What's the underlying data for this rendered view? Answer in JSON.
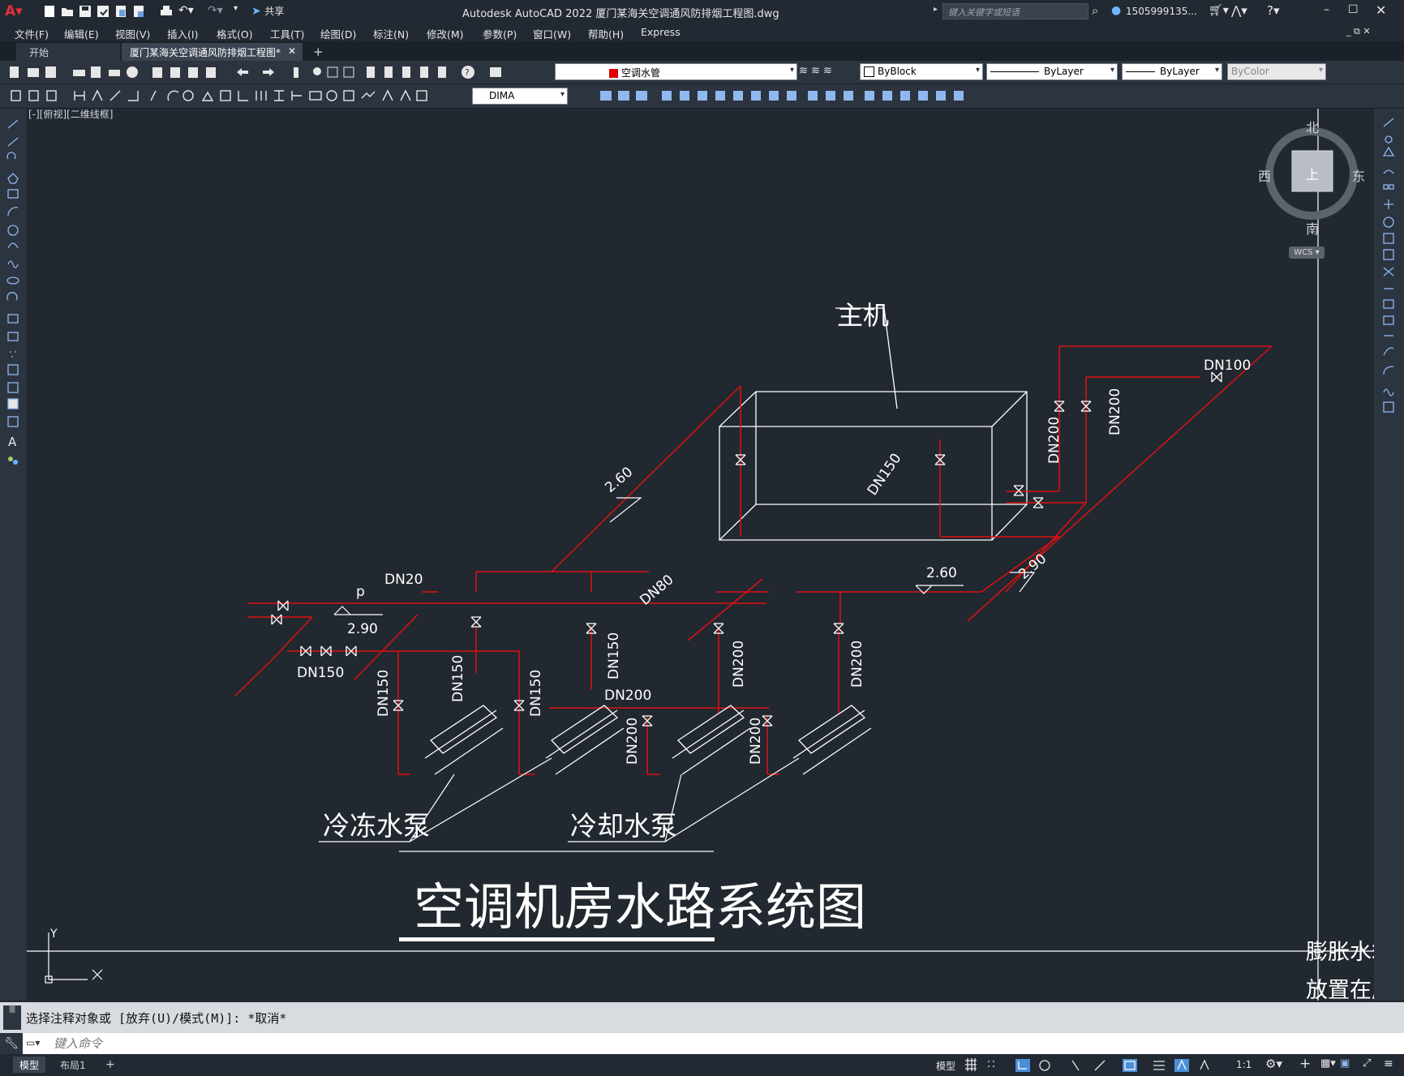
{
  "title_bar": {
    "app_title": "Autodesk AutoCAD 2022    厦门某海关空调通风防排烟工程图.dwg",
    "share_label": "共享",
    "search_placeholder": "键入关键字或短语",
    "user_name": "1505999135..."
  },
  "menu": [
    "文件(F)",
    "编辑(E)",
    "视图(V)",
    "插入(I)",
    "格式(O)",
    "工具(T)",
    "绘图(D)",
    "标注(N)",
    "修改(M)",
    "参数(P)",
    "窗口(W)",
    "帮助(H)",
    "Express"
  ],
  "tabs": {
    "start": "开始",
    "active": "厦门某海关空调通风防排烟工程图*"
  },
  "layer_combo": "空调水管",
  "color_combo": "ByBlock",
  "linetype_combo": "ByLayer",
  "lineweight_combo": "ByLayer",
  "plotstyle_combo": "ByColor",
  "dimstyle_combo": "DIMA",
  "viewport_label": "[-][俯视][二维线框]",
  "viewcube": {
    "north": "北",
    "south": "南",
    "east": "东",
    "west": "西",
    "top": "上",
    "wcs": "WCS"
  },
  "drawing": {
    "title": "空调机房水路系统图",
    "chiller_label": "主机",
    "chilled_pump_label": "冷冻水泵",
    "cooling_pump_label": "冷却水泵",
    "expansion_tank_line1": "膨胀水箱",
    "expansion_tank_line2": "放置在屋",
    "elev_260_a": "2.60",
    "elev_260_b": "2.60",
    "elev_290_a": "2.90",
    "elev_290_b": "2.90",
    "dn20": "DN20",
    "dn80": "DN80",
    "dn100": "DN100",
    "dn150_main": "DN150",
    "dn150_chiller": "DN150",
    "dn200_a": "DN200",
    "dn200_b": "DN200",
    "dn200_header": "DN200",
    "dn150_p1": "DN150",
    "dn150_p2": "DN150",
    "dn150_p3": "DN150",
    "dn150_p4": "DN150",
    "dn200_p5": "DN200",
    "dn200_p6": "DN200",
    "dn200_p7": "DN200",
    "dn200_p8": "DN200",
    "p_label": "p",
    "gauge_p": "P",
    "y_axis": "Y"
  },
  "command": {
    "history": "选择注释对象或 [放弃(U)/模式(M)]: *取消*",
    "placeholder": "键入命令"
  },
  "status": {
    "model_tab": "模型",
    "layout_tab": "布局1",
    "model_button": "模型",
    "scale": "1:1"
  }
}
